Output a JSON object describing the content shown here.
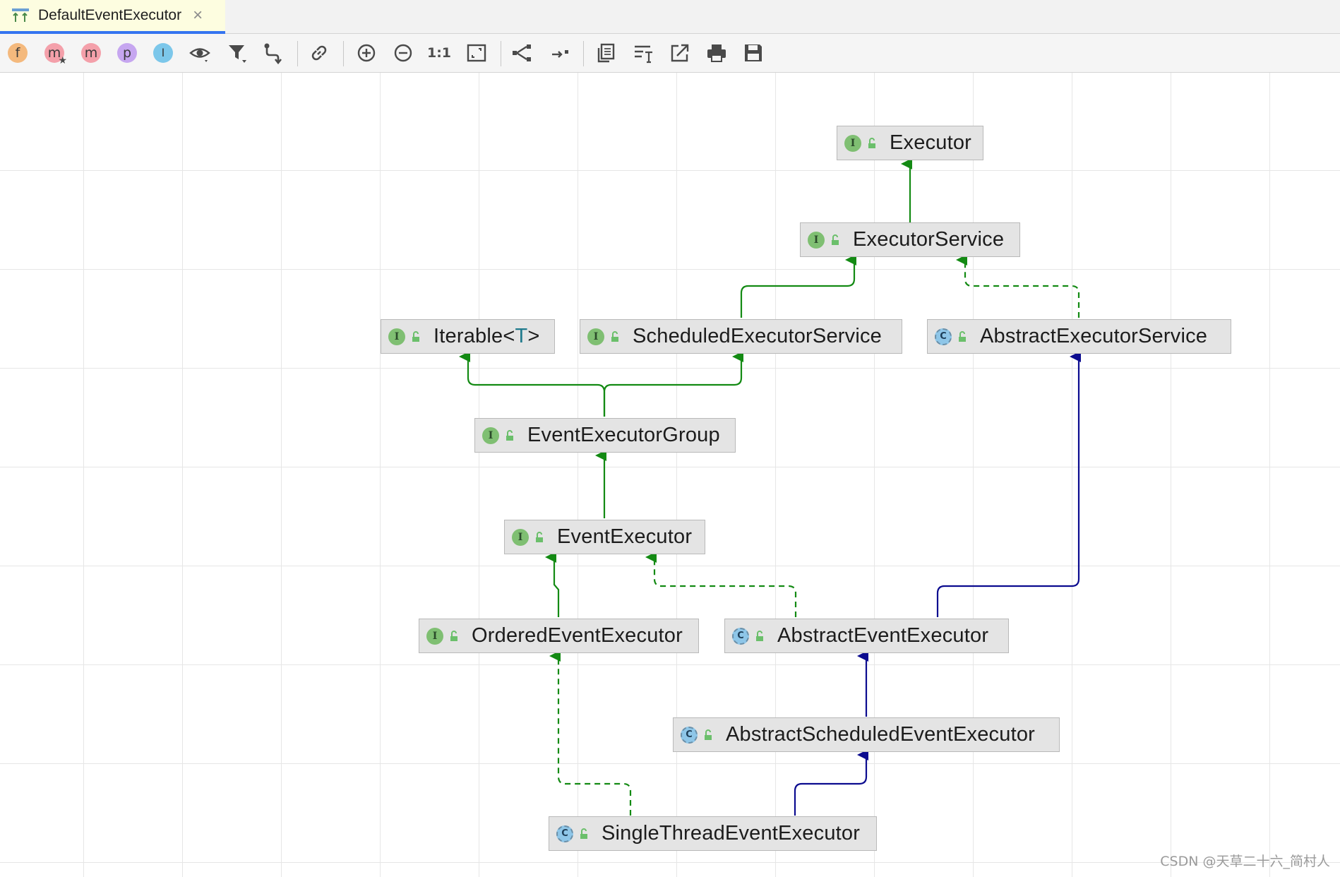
{
  "tab": {
    "title": "DefaultEventExecutor",
    "close_glyph": "×",
    "icon": "class-diagram-icon"
  },
  "toolbar": {
    "items": [
      {
        "name": "show-fields-button",
        "glyph": "f",
        "color": "#f4b97d"
      },
      {
        "name": "show-methods-starred-button",
        "glyph": "m",
        "color": "#f4a0aa"
      },
      {
        "name": "show-methods-button",
        "glyph": "m",
        "color": "#f4a0aa"
      },
      {
        "name": "show-properties-button",
        "glyph": "p",
        "color": "#c6a6f0"
      },
      {
        "name": "show-inner-classes-button",
        "glyph": "I",
        "color": "#7cc7ea"
      },
      {
        "name": "visibility-button",
        "icon": "eye-icon"
      },
      {
        "name": "filter-button",
        "icon": "filter-icon"
      },
      {
        "name": "edge-creation-button",
        "icon": "route-icon"
      },
      {
        "name": "show-dependencies-button",
        "icon": "link-icon"
      },
      {
        "name": "zoom-in-button",
        "icon": "plus-circle-icon"
      },
      {
        "name": "zoom-out-button",
        "icon": "minus-circle-icon"
      },
      {
        "name": "actual-size-button",
        "glyph": "1:1"
      },
      {
        "name": "fit-content-button",
        "icon": "fit-icon"
      },
      {
        "name": "layout-button",
        "icon": "hierarchy-icon"
      },
      {
        "name": "apply-layout-button",
        "icon": "arrow-layout-icon"
      },
      {
        "name": "copy-diagram-button",
        "icon": "copy-icon"
      },
      {
        "name": "edit-text-button",
        "icon": "text-edit-icon"
      },
      {
        "name": "export-button",
        "icon": "export-icon"
      },
      {
        "name": "print-button",
        "icon": "print-icon"
      },
      {
        "name": "save-button",
        "icon": "save-icon"
      }
    ]
  },
  "diagram": {
    "nodes": [
      {
        "id": "executor",
        "kind": "I",
        "name": "Executor"
      },
      {
        "id": "executor_service",
        "kind": "I",
        "name": "ExecutorService"
      },
      {
        "id": "iterable",
        "kind": "I",
        "name": "Iterable<",
        "type_param": "T",
        "name_suffix": ">"
      },
      {
        "id": "scheduled_executor_service",
        "kind": "I",
        "name": "ScheduledExecutorService"
      },
      {
        "id": "abstract_executor_service",
        "kind": "C",
        "name": "AbstractExecutorService"
      },
      {
        "id": "event_executor_group",
        "kind": "I",
        "name": "EventExecutorGroup"
      },
      {
        "id": "event_executor",
        "kind": "I",
        "name": "EventExecutor"
      },
      {
        "id": "ordered_event_executor",
        "kind": "I",
        "name": "OrderedEventExecutor"
      },
      {
        "id": "abstract_event_executor",
        "kind": "C",
        "name": "AbstractEventExecutor"
      },
      {
        "id": "abstract_scheduled_event_executor",
        "kind": "C",
        "name": "AbstractScheduledEventExecutor"
      },
      {
        "id": "single_thread_event_executor",
        "kind": "C",
        "name": "SingleThreadEventExecutor"
      }
    ],
    "edges": [
      {
        "from": "executor_service",
        "to": "executor",
        "type": "extends-interface"
      },
      {
        "from": "scheduled_executor_service",
        "to": "executor_service",
        "type": "extends-interface"
      },
      {
        "from": "abstract_executor_service",
        "to": "executor_service",
        "type": "implements"
      },
      {
        "from": "event_executor_group",
        "to": "iterable",
        "type": "extends-interface"
      },
      {
        "from": "event_executor_group",
        "to": "scheduled_executor_service",
        "type": "extends-interface"
      },
      {
        "from": "event_executor",
        "to": "event_executor_group",
        "type": "extends-interface"
      },
      {
        "from": "ordered_event_executor",
        "to": "event_executor",
        "type": "extends-interface"
      },
      {
        "from": "abstract_event_executor",
        "to": "event_executor",
        "type": "implements"
      },
      {
        "from": "abstract_event_executor",
        "to": "abstract_executor_service",
        "type": "extends-class"
      },
      {
        "from": "abstract_scheduled_event_executor",
        "to": "abstract_event_executor",
        "type": "extends-class"
      },
      {
        "from": "single_thread_event_executor",
        "to": "ordered_event_executor",
        "type": "implements"
      },
      {
        "from": "single_thread_event_executor",
        "to": "abstract_scheduled_event_executor",
        "type": "extends-class"
      }
    ],
    "colors": {
      "interface_edge": "#138a13",
      "class_edge": "#0b0b8f",
      "node_bg": "#e4e4e4"
    }
  },
  "watermark": "CSDN @天草二十六_简村人"
}
